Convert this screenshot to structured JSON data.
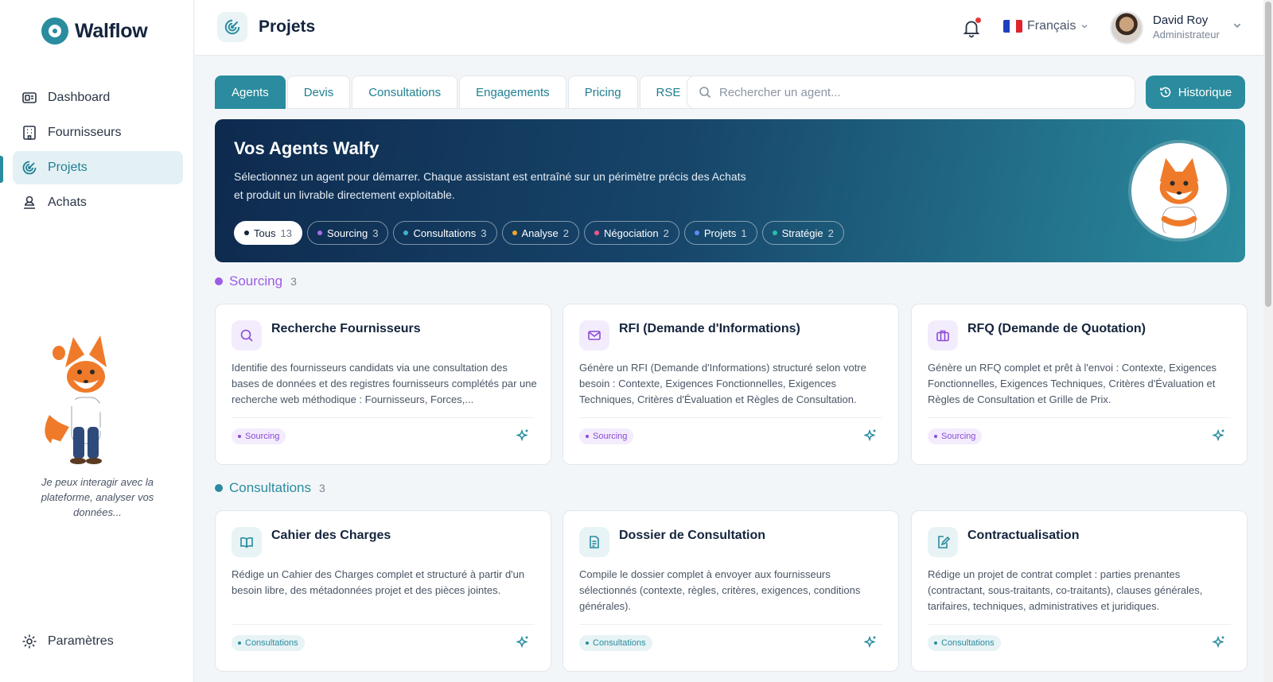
{
  "app": {
    "name": "Walflow"
  },
  "sidebar": {
    "items": [
      {
        "label": "Dashboard",
        "icon": "dashboard-icon"
      },
      {
        "label": "Fournisseurs",
        "icon": "building-icon"
      },
      {
        "label": "Projets",
        "icon": "target-icon",
        "active": true
      },
      {
        "label": "Achats",
        "icon": "user-stack-icon"
      }
    ],
    "mascot_caption": "Je peux interagir avec la plateforme, analyser vos données...",
    "settings_label": "Paramètres"
  },
  "header": {
    "title": "Projets",
    "language": "Français",
    "user": {
      "name": "David Roy",
      "role": "Administrateur"
    }
  },
  "tabs": [
    {
      "label": "Agents",
      "active": true
    },
    {
      "label": "Devis"
    },
    {
      "label": "Consultations"
    },
    {
      "label": "Engagements"
    },
    {
      "label": "Pricing"
    },
    {
      "label": "RSE"
    }
  ],
  "search": {
    "placeholder": "Rechercher un agent...",
    "value": ""
  },
  "history_button": "Historique",
  "hero": {
    "title": "Vos Agents Walfy",
    "description_line1": "Sélectionnez un agent pour démarrer. Chaque assistant est entraîné sur un périmètre précis des Achats",
    "description_line2": "et produit un livrable directement exploitable.",
    "filters": [
      {
        "label": "Tous",
        "count": "13",
        "color": "#14243d",
        "active": true
      },
      {
        "label": "Sourcing",
        "count": "3",
        "color": "#a56cf0"
      },
      {
        "label": "Consultations",
        "count": "3",
        "color": "#3fb3c4"
      },
      {
        "label": "Analyse",
        "count": "2",
        "color": "#f5a524"
      },
      {
        "label": "Négociation",
        "count": "2",
        "color": "#f0568a"
      },
      {
        "label": "Projets",
        "count": "1",
        "color": "#5b8cf5"
      },
      {
        "label": "Stratégie",
        "count": "2",
        "color": "#26c0a8"
      }
    ]
  },
  "sections": [
    {
      "title": "Sourcing",
      "count": "3",
      "color": "#9b5de5",
      "cards": [
        {
          "title": "Recherche Fournisseurs",
          "icon": "search-icon",
          "description": "Identifie des fournisseurs candidats via une consultation des bases de données et des registres fournisseurs complétés par une recherche web méthodique : Fournisseurs, Forces,...",
          "tag": "Sourcing"
        },
        {
          "title": "RFI (Demande d'Informations)",
          "icon": "mail-icon",
          "description": "Génère un RFI (Demande d'Informations) structuré selon votre besoin : Contexte, Exigences Fonctionnelles, Exigences Techniques, Critères d'Évaluation et Règles de Consultation.",
          "tag": "Sourcing"
        },
        {
          "title": "RFQ (Demande de Quotation)",
          "icon": "briefcase-icon",
          "description": "Génère un RFQ complet et prêt à l'envoi : Contexte, Exigences Fonctionnelles, Exigences Techniques, Critères d'Évaluation et Règles de Consultation et Grille de Prix.",
          "tag": "Sourcing"
        }
      ]
    },
    {
      "title": "Consultations",
      "count": "3",
      "color": "#2a8c9e",
      "cards": [
        {
          "title": "Cahier des Charges",
          "icon": "book-icon",
          "description": "Rédige un Cahier des Charges complet et structuré à partir d'un besoin libre, des métadonnées projet et des pièces jointes.",
          "tag": "Consultations"
        },
        {
          "title": "Dossier de Consultation",
          "icon": "document-icon",
          "description": "Compile le dossier complet à envoyer aux fournisseurs sélectionnés (contexte, règles, critères, exigences, conditions générales).",
          "tag": "Consultations"
        },
        {
          "title": "Contractualisation",
          "icon": "edit-document-icon",
          "description": "Rédige un projet de contrat complet : parties prenantes (contractant, sous-traitants, co-traitants), clauses générales, tarifaires, techniques, administratives et juridiques.",
          "tag": "Consultations"
        }
      ]
    }
  ]
}
